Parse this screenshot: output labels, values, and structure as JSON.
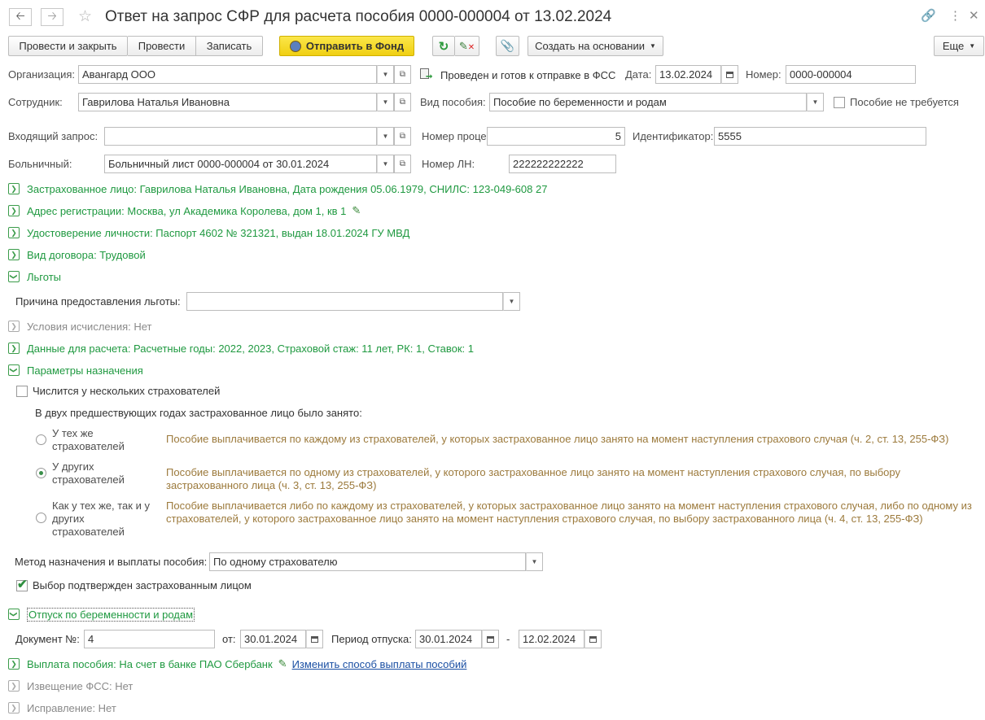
{
  "header": {
    "title": "Ответ на запрос СФР для расчета пособия 0000-000004 от 13.02.2024"
  },
  "toolbar": {
    "post_close": "Провести и закрыть",
    "post": "Провести",
    "save": "Записать",
    "send_fund": "Отправить в Фонд",
    "create_based": "Создать на основании",
    "more": "Еще"
  },
  "form": {
    "org_label": "Организация:",
    "org_value": "Авангард ООО",
    "status_text": "Проведен и готов к отправке в ФСС",
    "date_label": "Дата:",
    "date_value": "13.02.2024",
    "number_label": "Номер:",
    "number_value": "0000-000004",
    "employee_label": "Сотрудник:",
    "employee_value": "Гаврилова Наталья Ивановна",
    "benefit_type_label": "Вид пособия:",
    "benefit_type_value": "Пособие по беременности и родам",
    "not_required_label": "Пособие не требуется",
    "incoming_label": "Входящий запрос:",
    "incoming_value": "",
    "process_label": "Номер процесса:",
    "process_value": "5",
    "ident_label": "Идентификатор:",
    "ident_value": "5555",
    "sick_label": "Больничный:",
    "sick_value": "Больничный лист 0000-000004 от 30.01.2024",
    "ln_label": "Номер ЛН:",
    "ln_value": "222222222222"
  },
  "groups": {
    "insured": "Застрахованное лицо: Гаврилова Наталья Ивановна, Дата рождения 05.06.1979, СНИЛС: 123-049-608 27",
    "address": "Адрес регистрации: Москва, ул Академика Королева, дом 1, кв 1",
    "identity": "Удостоверение личности: Паспорт 4602 № 321321, выдан 18.01.2024 ГУ МВД",
    "contract": "Вид договора: Трудовой",
    "benefits": "Льготы",
    "benefit_reason_label": "Причина предоставления льготы:",
    "benefit_reason_value": "",
    "calc_conditions": "Условия исчисления: Нет",
    "calc_data": "Данные для расчета: Расчетные годы: 2022, 2023, Страховой стаж: 11 лет, РК: 1, Ставок: 1",
    "params": "Параметры назначения",
    "several_insurers": "Числится у нескольких страхователей",
    "prev_years_text": "В двух предшествующих годах застрахованное лицо было занято:",
    "radio_same": "У тех же\nстрахователей",
    "radio_same_desc": "Пособие выплачивается по каждому из страхователей, у которых застрахованное лицо занято на момент наступления страхового случая (ч. 2, ст. 13, 255-ФЗ)",
    "radio_other": "У других\nстрахователей",
    "radio_other_desc": "Пособие выплачивается по одному из страхователей, у которого застрахованное лицо занято на момент наступления страхового случая, по выбору застрахованного лица (ч. 3, ст. 13, 255-ФЗ)",
    "radio_both": "Как у тех же, так и у\nдругих\nстрахователей",
    "radio_both_desc": "Пособие выплачивается либо по каждому из страхователей, у которых застрахованное лицо занято на момент наступления страхового случая, либо по одному из страхователей, у которого застрахованное лицо занято на момент наступления страхового случая, по выбору застрахованного лица (ч. 4, ст. 13, 255-ФЗ)",
    "method_label": "Метод назначения и выплаты пособия:",
    "method_value": "По одному страхователю",
    "confirmed_label": "Выбор подтвержден застрахованным лицом",
    "maternity": "Отпуск по беременности и родам",
    "doc_label": "Документ №:",
    "doc_value": "4",
    "from_label": "от:",
    "from_value": "30.01.2024",
    "period_label": "Период отпуска:",
    "period_start": "30.01.2024",
    "period_dash": "-",
    "period_end": "12.02.2024",
    "payment": "Выплата пособия: На счет в банке ПАО Сбербанк",
    "payment_link": "Изменить способ выплаты пособий",
    "fss_notice": "Извещение ФСС: Нет",
    "correction": "Исправление: Нет"
  },
  "state": {
    "radio_selected": "other",
    "not_required_checked": false,
    "several_insurers_checked": false,
    "confirmed_checked": true
  }
}
